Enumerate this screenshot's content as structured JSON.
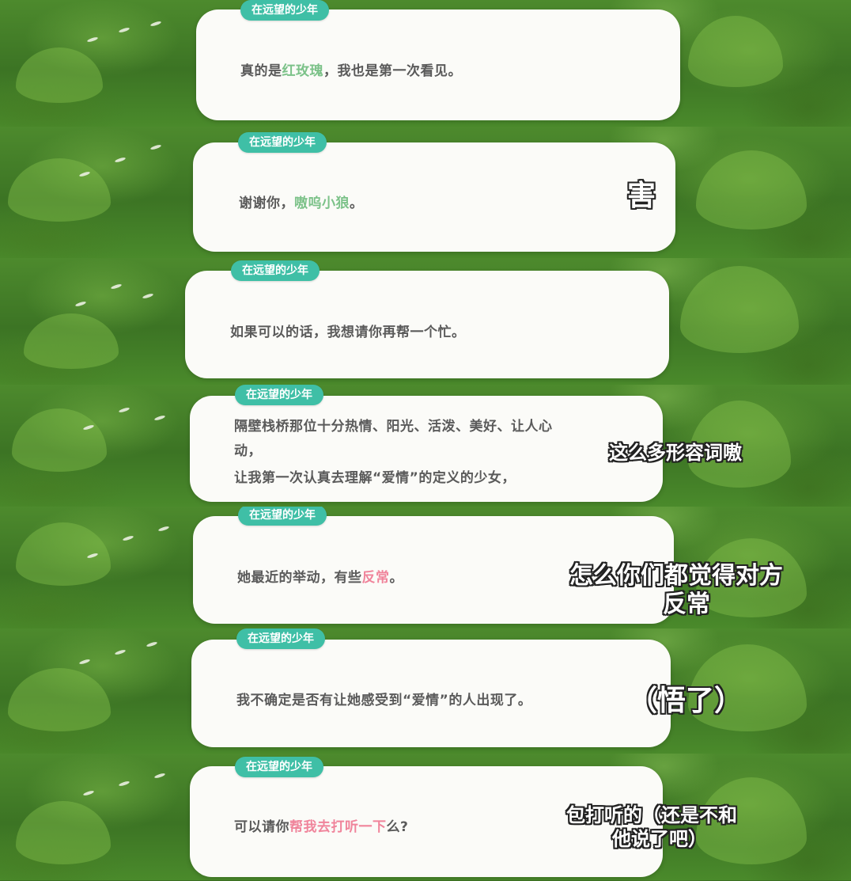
{
  "speaker": "在远望的少年",
  "panels": [
    {
      "segments": [
        {
          "text": "真的是",
          "hl": ""
        },
        {
          "text": "红玫瑰",
          "hl": "green"
        },
        {
          "text": "，我也是第一次看见。",
          "hl": ""
        }
      ]
    },
    {
      "segments": [
        {
          "text": "谢谢你，",
          "hl": ""
        },
        {
          "text": "嗷呜小狼",
          "hl": "green"
        },
        {
          "text": "。",
          "hl": ""
        }
      ],
      "caption": "害"
    },
    {
      "segments": [
        {
          "text": "如果可以的话，我想请你再帮一个忙。",
          "hl": ""
        }
      ]
    },
    {
      "lines": [
        "隔壁栈桥那位十分热情、阳光、活泼、美好、让人心",
        "动，",
        "让我第一次认真去理解“爱情”的定义的少女，"
      ],
      "caption": "这么多形容词嗷"
    },
    {
      "segments": [
        {
          "text": "她最近的举动，有些",
          "hl": ""
        },
        {
          "text": "反常",
          "hl": "pink"
        },
        {
          "text": "。",
          "hl": ""
        }
      ],
      "caption_lines": [
        "怎么你们都觉得对方",
        "反常"
      ]
    },
    {
      "segments": [
        {
          "text": "我不确定是否有让她感受到“爱情”的人出现了。",
          "hl": ""
        }
      ],
      "caption": "（悟了）"
    },
    {
      "segments": [
        {
          "text": "可以请你",
          "hl": ""
        },
        {
          "text": "帮我去打听一下",
          "hl": "pink"
        },
        {
          "text": "么?",
          "hl": ""
        }
      ],
      "caption_lines": [
        "包打听的（还是不和",
        "他说了吧）"
      ]
    }
  ],
  "colors": {
    "tag_bg": "#3fbfa6",
    "highlight_green": "#7cc289",
    "highlight_pink": "#f0849b",
    "text": "#5a5a5a"
  }
}
